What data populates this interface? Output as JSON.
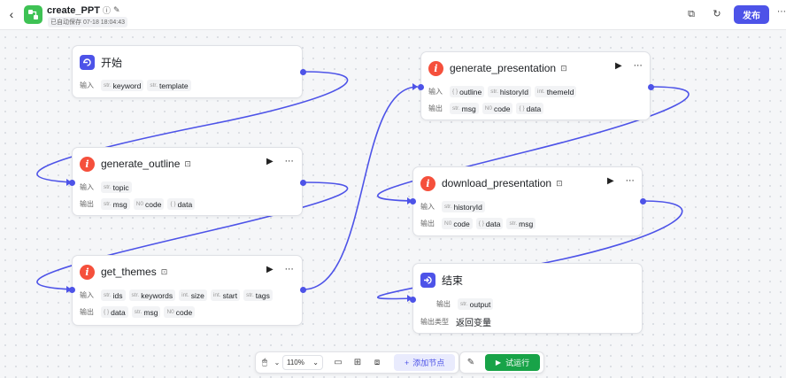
{
  "header": {
    "back_icon": "‹",
    "title": "create_PPT",
    "title_info_icon": "ⓘ",
    "title_edit_icon": "✎",
    "autosave": "已自动保存 07-18 18:04:43",
    "copy_icon": "⧉",
    "history_icon": "↻",
    "publish_label": "发布",
    "more_icon": "⋯"
  },
  "nodes": {
    "start": {
      "title": "开始",
      "input_label": "输入",
      "inputs": [
        {
          "type": "str.",
          "name": "keyword"
        },
        {
          "type": "str.",
          "name": "template"
        }
      ]
    },
    "generate_outline": {
      "title": "generate_outline",
      "input_label": "输入",
      "output_label": "输出",
      "inputs": [
        {
          "type": "str.",
          "name": "topic"
        }
      ],
      "outputs": [
        {
          "type": "str.",
          "name": "msg"
        },
        {
          "type": "N0",
          "name": "code"
        },
        {
          "type": "{ }",
          "name": "data"
        }
      ]
    },
    "get_themes": {
      "title": "get_themes",
      "input_label": "输入",
      "output_label": "输出",
      "inputs": [
        {
          "type": "str.",
          "name": "ids"
        },
        {
          "type": "str.",
          "name": "keywords"
        },
        {
          "type": "int.",
          "name": "size"
        },
        {
          "type": "int.",
          "name": "start"
        },
        {
          "type": "str.",
          "name": "tags"
        }
      ],
      "outputs": [
        {
          "type": "{ }",
          "name": "data"
        },
        {
          "type": "str.",
          "name": "msg"
        },
        {
          "type": "N0",
          "name": "code"
        }
      ]
    },
    "generate_presentation": {
      "title": "generate_presentation",
      "input_label": "输入",
      "output_label": "输出",
      "inputs": [
        {
          "type": "{ }",
          "name": "outline"
        },
        {
          "type": "str.",
          "name": "historyId"
        },
        {
          "type": "int.",
          "name": "themeId"
        }
      ],
      "outputs": [
        {
          "type": "str.",
          "name": "msg"
        },
        {
          "type": "N0",
          "name": "code"
        },
        {
          "type": "{ }",
          "name": "data"
        }
      ]
    },
    "download_presentation": {
      "title": "download_presentation",
      "input_label": "输入",
      "output_label": "输出",
      "inputs": [
        {
          "type": "str.",
          "name": "historyId"
        }
      ],
      "outputs": [
        {
          "type": "N0",
          "name": "code"
        },
        {
          "type": "{ }",
          "name": "data"
        },
        {
          "type": "str.",
          "name": "msg"
        }
      ]
    },
    "end": {
      "title": "结束",
      "output_label": "输出",
      "outputs": [
        {
          "type": "str.",
          "name": "output"
        }
      ],
      "output_type_label": "输出类型",
      "output_type_value": "返回变量"
    }
  },
  "node_actions": {
    "run_icon": "▶",
    "more_icon": "⋯",
    "plugin_icon": "⊡"
  },
  "toolbar": {
    "mouse_icon": "🖱",
    "chevron_icon": "⌄",
    "zoom": "110%",
    "comment_icon": "▭",
    "layout_icon": "⊞",
    "minimap_icon": "⧈",
    "add_node_label": "添加节点",
    "add_icon": "+",
    "test_icon": "✎",
    "run_label": "试运行",
    "run_icon": "▶"
  },
  "colors": {
    "accent": "#4d53e8",
    "plugin_icon": "#f5503c",
    "run_green": "#18a348",
    "logo_green": "#3ec254",
    "edge": "#4d53e8"
  }
}
